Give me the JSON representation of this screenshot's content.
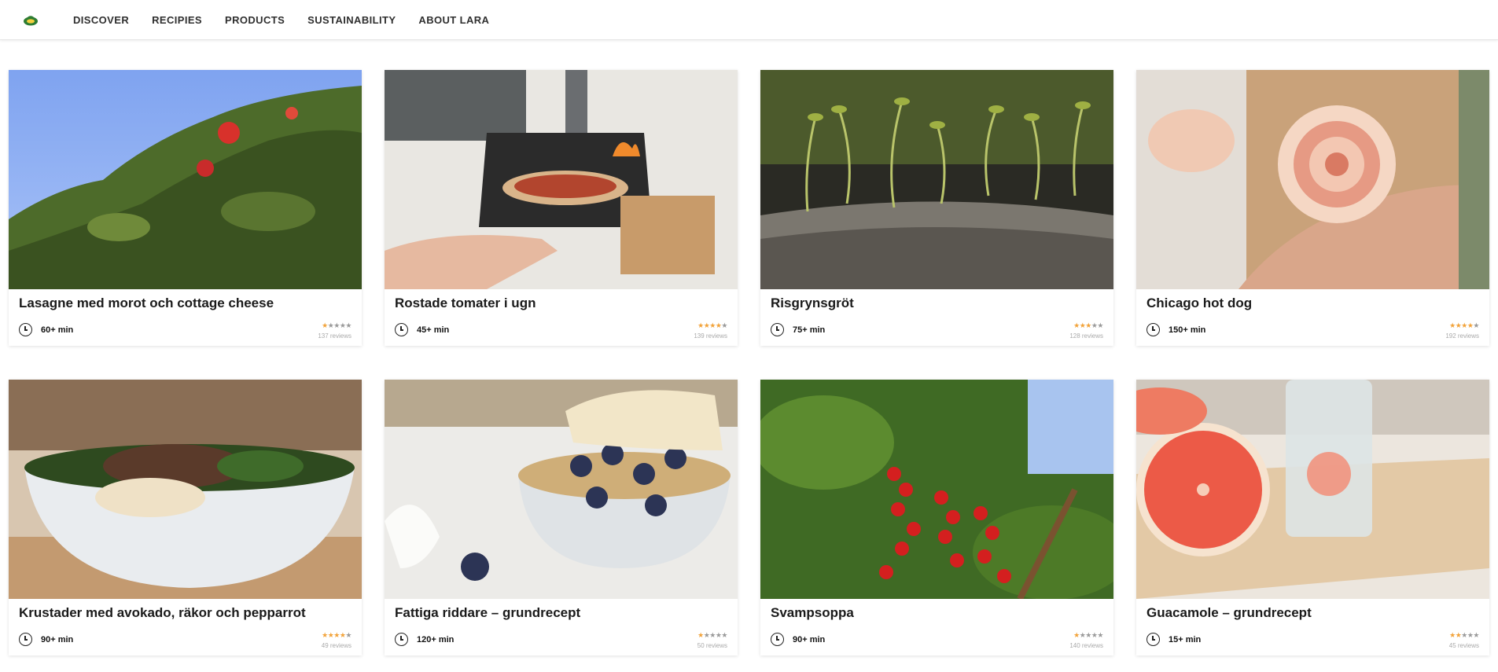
{
  "nav": {
    "items": [
      "DISCOVER",
      "RECIPIES",
      "PRODUCTS",
      "SUSTAINABILITY",
      "ABOUT LARA"
    ]
  },
  "colors": {
    "star_on": "#f2a33a",
    "star_off": "#9a9a9a",
    "accent_logo": "#2e7d32"
  },
  "recipes": [
    {
      "title": "Lasagne med morot och cottage cheese",
      "time": "60+ min",
      "rating": 1,
      "reviews": "137 reviews",
      "image": "flowering-bush-photo"
    },
    {
      "title": "Rostade tomater i ugn",
      "time": "45+ min",
      "rating": 4,
      "reviews": "139 reviews",
      "image": "pizza-oven-photo"
    },
    {
      "title": "Risgrynsgröt",
      "time": "75+ min",
      "rating": 3,
      "reviews": "128 reviews",
      "image": "seedlings-photo"
    },
    {
      "title": "Chicago hot dog",
      "time": "150+ min",
      "rating": 4,
      "reviews": "192 reviews",
      "image": "apple-rose-pastry-photo"
    },
    {
      "title": "Krustader med avokado, räkor och pepparrot",
      "time": "90+ min",
      "rating": 4,
      "reviews": "49 reviews",
      "image": "noodle-bowl-photo"
    },
    {
      "title": "Fattiga riddare – grundrecept",
      "time": "120+ min",
      "rating": 1,
      "reviews": "50 reviews",
      "image": "granola-blueberry-photo"
    },
    {
      "title": "Svampsoppa",
      "time": "90+ min",
      "rating": 1,
      "reviews": "140 reviews",
      "image": "redcurrant-photo"
    },
    {
      "title": "Guacamole – grundrecept",
      "time": "15+ min",
      "rating": 2,
      "reviews": "45 reviews",
      "image": "grapefruit-photo"
    }
  ]
}
